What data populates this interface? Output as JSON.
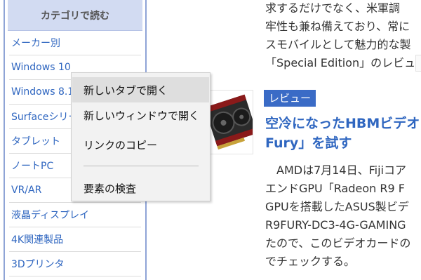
{
  "sidebar": {
    "header": "カテゴリで読む",
    "items": [
      {
        "label": "メーカー別"
      },
      {
        "label": "Windows 10"
      },
      {
        "label": "Windows 8.1"
      },
      {
        "label": "Surfaceシリーズ"
      },
      {
        "label": "タブレット"
      },
      {
        "label": "ノートPC"
      },
      {
        "label": "VR/AR"
      },
      {
        "label": "液晶ディスプレイ"
      },
      {
        "label": "4K関連製品"
      },
      {
        "label": "3Dプリンタ"
      }
    ]
  },
  "article_prev": {
    "lines": [
      "求するだけでなく、米軍調",
      "牢性も兼ね備えており、常に",
      "スモバイルとして魅力的な製",
      "「Special Edition」のレビュ"
    ]
  },
  "article": {
    "badge": "レビュー",
    "title_lines": [
      "空冷になったHBMビデオ",
      "Fury」を試す"
    ],
    "body_lines": [
      "　AMDは7月14日、Fijiコア",
      "エンドGPU「Radeon R9 F",
      "GPUを搭載したASUS製ビデ",
      "R9FURY-DC3-4G-GAMING",
      "たので、このビデオカードの",
      "でチェックする。"
    ],
    "thumbnail": "graphics-card-image"
  },
  "context_menu": {
    "items": [
      {
        "label": "新しいタブで開く",
        "highlighted": true
      },
      {
        "label": "新しいウィンドウで開く"
      },
      {
        "label": "リンクのコピー"
      },
      {
        "label": "要素の検査"
      }
    ]
  },
  "colors": {
    "link": "#2f66c0",
    "sidebar_header_bg": "#d2dbf2",
    "sidebar_border": "#8fa4d6",
    "badge_bg": "#3a6bc6",
    "menu_bg": "#f2f2f2",
    "menu_highlight": "#dedede"
  }
}
